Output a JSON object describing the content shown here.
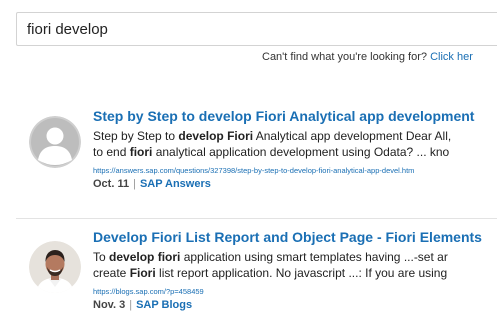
{
  "search": {
    "query": "fiori develop"
  },
  "help": {
    "text": "Can't find what you're looking for?",
    "link_label": "Click her"
  },
  "results": [
    {
      "title": "Step by Step to develop Fiori Analytical app development",
      "snippet_line1": [
        {
          "text": "Step by Step to ",
          "bold": false
        },
        {
          "text": "develop Fiori",
          "bold": true
        },
        {
          "text": " Analytical app development Dear All,",
          "bold": false
        }
      ],
      "snippet_line2": [
        {
          "text": "to end ",
          "bold": false
        },
        {
          "text": "fiori",
          "bold": true
        },
        {
          "text": " analytical application development using Odata? ... kno",
          "bold": false
        }
      ],
      "url": "https://answers.sap.com/questions/327398/step-by-step-to-develop-fiori-analytical-app-devel.htm",
      "date": "Oct. 11",
      "source": "SAP Answers"
    },
    {
      "title": "Develop Fiori List Report and Object Page - Fiori Elements",
      "snippet_line1": [
        {
          "text": "To ",
          "bold": false
        },
        {
          "text": "develop fiori",
          "bold": true
        },
        {
          "text": " application using smart templates having ...-set ar",
          "bold": false
        }
      ],
      "snippet_line2": [
        {
          "text": "create ",
          "bold": false
        },
        {
          "text": "Fiori",
          "bold": true
        },
        {
          "text": " list report application. No javascript ...: If you are using",
          "bold": false
        }
      ],
      "url": "https://blogs.sap.com/?p=458459",
      "date": "Nov. 3",
      "source": "SAP Blogs"
    }
  ],
  "meta_separator": "|",
  "colors": {
    "link": "#1a6fb4",
    "text": "#222222",
    "border": "#d3d3d3",
    "placeholder_avatar": "#b9b9b9"
  },
  "icons": {
    "result_1_avatar": "default-user-avatar-icon",
    "result_2_avatar": "user-photo-avatar"
  }
}
